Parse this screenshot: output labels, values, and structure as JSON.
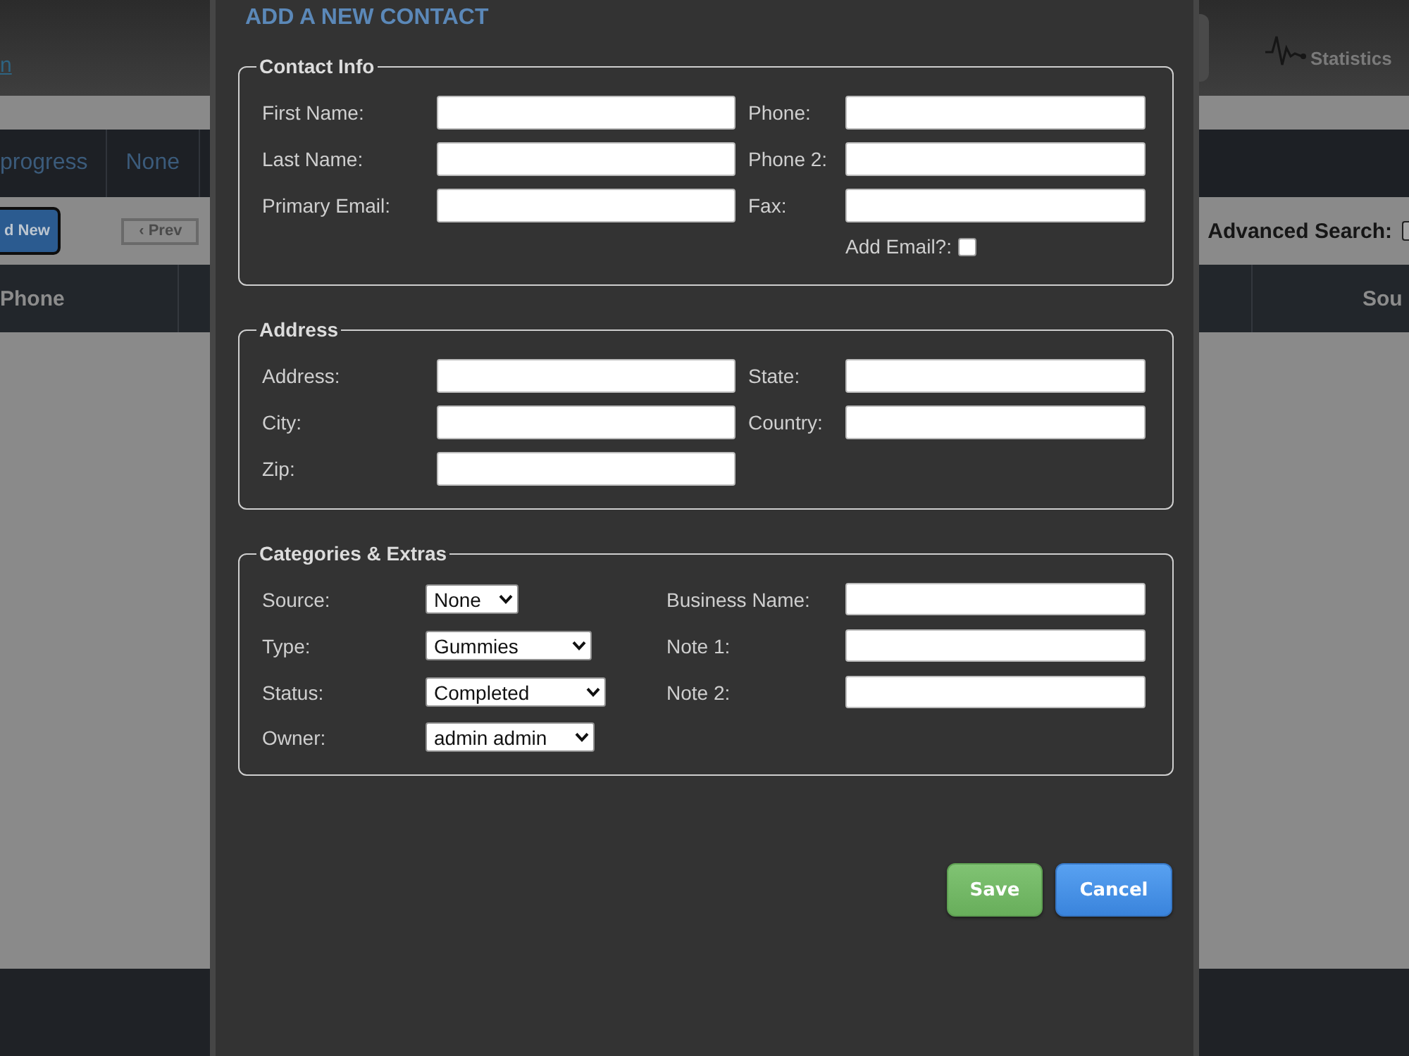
{
  "page": {
    "header": {
      "link": "n",
      "statistics": "Statistics"
    },
    "tabs": [
      {
        "label": "progress",
        "selected": false
      },
      {
        "label": "None",
        "selected": false
      }
    ],
    "toolbar": {
      "add_button": "d New",
      "prev_button": "‹ Prev",
      "advanced_search": {
        "label": "Advanced Search:",
        "checked": false
      }
    },
    "table": {
      "columns": [
        "Phone",
        "Sou"
      ]
    }
  },
  "dialog": {
    "title": "ADD A NEW CONTACT",
    "sections": [
      {
        "legend": "Contact Info",
        "left": [
          {
            "label": "First Name:",
            "kind": "text"
          },
          {
            "label": "Last Name:",
            "kind": "text"
          },
          {
            "label": "Primary Email:",
            "kind": "text"
          }
        ],
        "right": [
          {
            "label": "Phone:",
            "kind": "text"
          },
          {
            "label": "Phone 2:",
            "kind": "text"
          },
          {
            "label": "Fax:",
            "kind": "text"
          },
          {
            "label": "Add Email?:",
            "kind": "checkbox",
            "checked": false
          }
        ]
      },
      {
        "legend": "Address",
        "left": [
          {
            "label": "Address:",
            "kind": "text"
          },
          {
            "label": "City:",
            "kind": "text"
          },
          {
            "label": "Zip:",
            "kind": "text"
          }
        ],
        "right": [
          {
            "label": "State:",
            "kind": "text"
          },
          {
            "label": "Country:",
            "kind": "text"
          }
        ]
      },
      {
        "legend": "Categories & Extras",
        "left": [
          {
            "label": "Source:",
            "kind": "select",
            "value": "None"
          },
          {
            "label": "Type:",
            "kind": "select",
            "value": "Gummies"
          },
          {
            "label": "Status:",
            "kind": "select",
            "value": "Completed"
          },
          {
            "label": "Owner:",
            "kind": "select",
            "value": "admin admin"
          }
        ],
        "right": [
          {
            "label": "Business Name:",
            "kind": "text"
          },
          {
            "label": "Note 1:",
            "kind": "text"
          },
          {
            "label": "Note 2:",
            "kind": "text"
          }
        ]
      }
    ],
    "buttons": [
      {
        "label": "Save",
        "kind": "save"
      },
      {
        "label": "Cancel",
        "kind": "cancel"
      }
    ]
  }
}
